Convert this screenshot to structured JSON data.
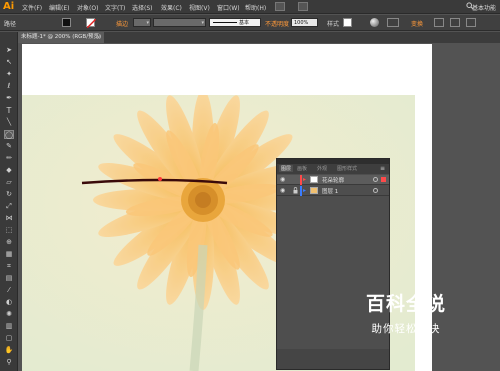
{
  "app": {
    "logo": "Ai",
    "workspace": "基本功能"
  },
  "menu": [
    "文件(F)",
    "编辑(E)",
    "对象(O)",
    "文字(T)",
    "选择(S)",
    "效果(C)",
    "视图(V)",
    "窗口(W)",
    "帮助(H)"
  ],
  "control_bar": {
    "selection_label": "路径",
    "stroke_label": "描边",
    "brush_label": "基本",
    "opacity_label": "不透明度",
    "opacity_value": "100%",
    "style_label": "样式",
    "transform_label": "变换"
  },
  "document_tab": {
    "title": "未标题-1* @ 200% (RGB/预览)",
    "close": "×"
  },
  "layers_panel": {
    "tabs": [
      "图层",
      "画板",
      "外观",
      "图形样式"
    ],
    "layers": [
      {
        "name": "花朵轮廓",
        "color": "#ff4a4a",
        "selected": true
      },
      {
        "name": "图层 1",
        "color": "#3b7cff",
        "selected": false
      }
    ]
  },
  "watermark": {
    "title": "百科全说",
    "subtitle": "助你轻松解决"
  },
  "colors": {
    "logo": "#ff9a00",
    "accent": "#ff8a00",
    "ui_dark": "#3a3a3a",
    "panel": "#4e4e4e"
  }
}
